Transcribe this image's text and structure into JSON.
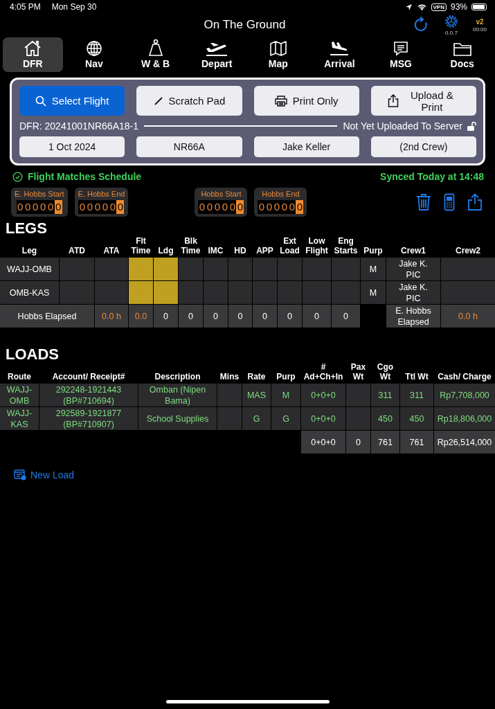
{
  "status_bar": {
    "time": "4:05 PM",
    "date": "Mon Sep 30",
    "vpn": "VPN",
    "battery": "93%"
  },
  "header": {
    "title": "On The Ground",
    "version": "0.0.7",
    "badge": "v2",
    "timer": "00:00"
  },
  "tabs": [
    {
      "label": "DFR",
      "selected": true
    },
    {
      "label": "Nav",
      "selected": false
    },
    {
      "label": "W & B",
      "selected": false
    },
    {
      "label": "Depart",
      "selected": false
    },
    {
      "label": "Map",
      "selected": false
    },
    {
      "label": "Arrival",
      "selected": false
    },
    {
      "label": "MSG",
      "selected": false
    },
    {
      "label": "Docs",
      "selected": false
    }
  ],
  "actions": [
    {
      "label": "Select Flight",
      "kind": "primary"
    },
    {
      "label": "Scratch Pad",
      "kind": "secondary"
    },
    {
      "label": "Print Only",
      "kind": "secondary"
    },
    {
      "label": "Upload & Print",
      "kind": "secondary"
    }
  ],
  "dfr": {
    "id": "DFR: 20241001NR66A18-1",
    "upload_status": "Not Yet Uploaded To Server",
    "locked": false
  },
  "fields": [
    "1 Oct 2024",
    "NR66A",
    "Jake Keller",
    "(2nd Crew)"
  ],
  "schedule_status": "Flight Matches Schedule",
  "sync_status": "Synced Today at 14:48",
  "meters": [
    {
      "label": "E. Hobbs Start",
      "digits": [
        "0",
        "0",
        "0",
        "0",
        "0"
      ],
      "tenth": "0"
    },
    {
      "label": "E. Hobbs End",
      "digits": [
        "0",
        "0",
        "0",
        "0",
        "0"
      ],
      "tenth": "0"
    },
    {
      "label": "Hobbs Start",
      "digits": [
        "0",
        "0",
        "0",
        "0",
        "0"
      ],
      "tenth": "0"
    },
    {
      "label": "Hobbs End",
      "digits": [
        "0",
        "0",
        "0",
        "0",
        "0"
      ],
      "tenth": "0"
    }
  ],
  "legs": {
    "title": "LEGS",
    "columns": [
      "Leg",
      "ATD",
      "ATA",
      "Flt Time",
      "Ldg",
      "Blk Time",
      "IMC",
      "HD",
      "APP",
      "Ext Load",
      "Low Flight",
      "Eng Starts",
      "Purp",
      "Crew1",
      "Crew2"
    ],
    "rows": [
      {
        "leg": "WAJJ-OMB",
        "flt_time_flagged": true,
        "ldg_flagged": true,
        "purp": "M",
        "crew1_name": "Jake K.",
        "crew1_role": "PIC"
      },
      {
        "leg": "OMB-KAS",
        "flt_time_flagged": true,
        "ldg_flagged": true,
        "purp": "M",
        "crew1_name": "Jake K.",
        "crew1_role": "PIC"
      }
    ],
    "totals": {
      "label": "Hobbs Elapsed",
      "values": [
        {
          "text": "0.0 h",
          "accent": true
        },
        {
          "text": "0.0",
          "accent": true
        },
        {
          "text": "0",
          "accent": false
        },
        {
          "text": "0",
          "accent": false
        },
        {
          "text": "0",
          "accent": false
        },
        {
          "text": "0",
          "accent": false
        },
        {
          "text": "0",
          "accent": false
        },
        {
          "text": "0",
          "accent": false
        },
        {
          "text": "0",
          "accent": false
        },
        {
          "text": "0",
          "accent": false
        }
      ],
      "e_hobbs_label": "E. Hobbs Elapsed",
      "e_hobbs_value": "0.0 h"
    }
  },
  "loads": {
    "title": "LOADS",
    "columns": [
      "Route",
      "Account/ Receipt#",
      "Description",
      "Mins",
      "Rate",
      "Purp",
      "# Ad+Ch+In",
      "Pax Wt",
      "Cgo Wt",
      "Ttl Wt",
      "Cash/ Charge"
    ],
    "rows": [
      {
        "route": "WAJJ-OMB",
        "account": "292248-1921443 (BP#710694)",
        "description": "Omban (Nipen Bama)",
        "rate": "MAS",
        "purp": "M",
        "count": "0+0+0",
        "cgo": "311",
        "ttl": "311",
        "cash": "Rp7,708,000"
      },
      {
        "route": "WAJJ-KAS",
        "account": "292589-1921877 (BP#710907)",
        "description": "School Supplies",
        "rate": "G",
        "purp": "G",
        "count": "0+0+0",
        "cgo": "450",
        "ttl": "450",
        "cash": "Rp18,806,000"
      }
    ],
    "totals": {
      "count": "0+0+0",
      "pax": "0",
      "cgo": "761",
      "ttl": "761",
      "cash": "Rp26,514,000"
    }
  },
  "new_load": "New Load"
}
